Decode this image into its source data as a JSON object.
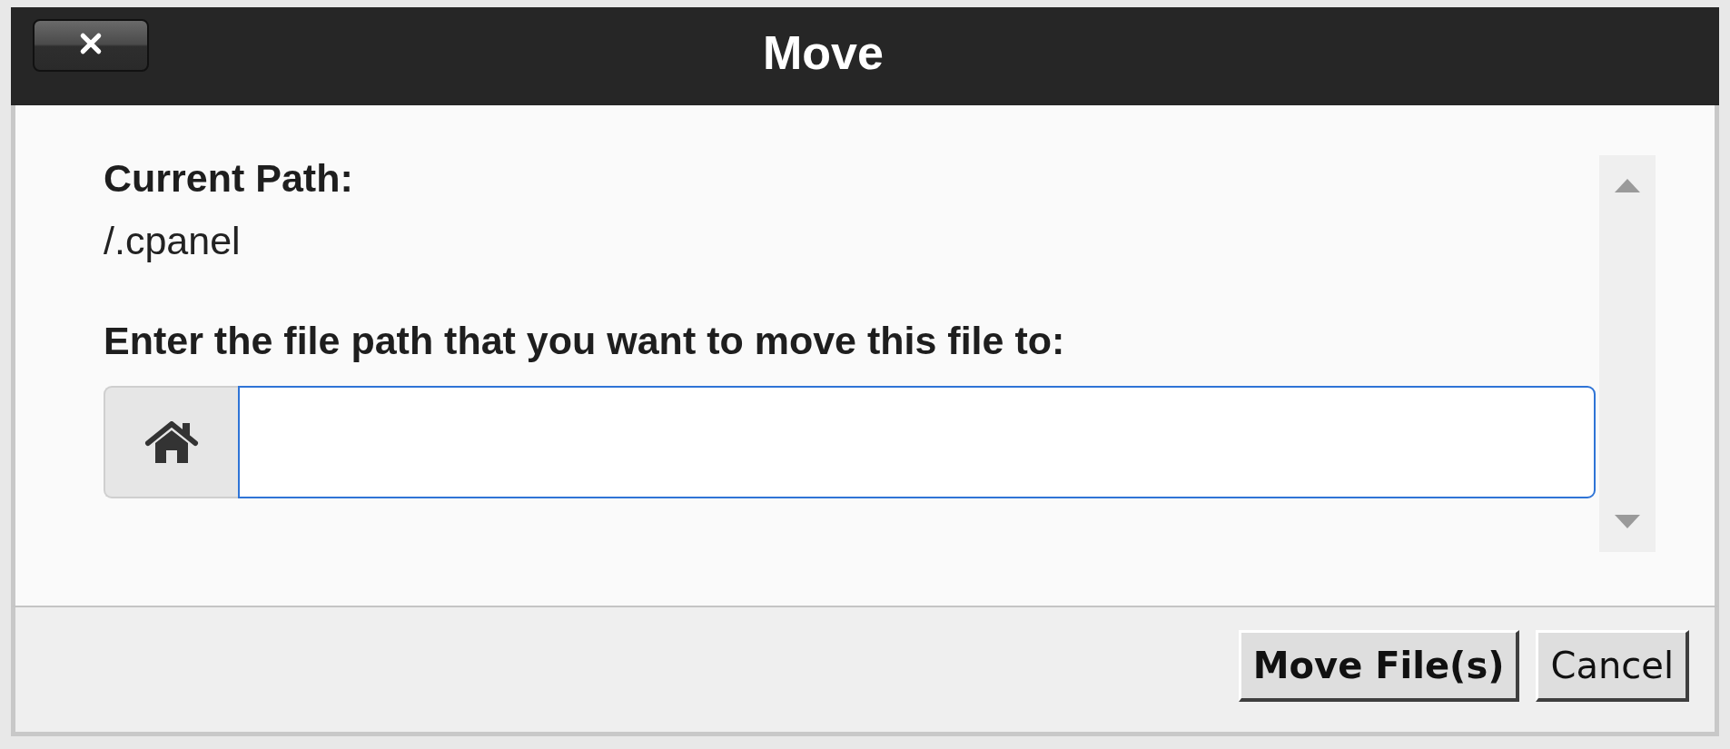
{
  "dialog": {
    "title": "Move"
  },
  "current_path": {
    "label": "Current Path:",
    "value": "/.cpanel"
  },
  "destination": {
    "label": "Enter the file path that you want to move this file to:",
    "focused": true
  },
  "buttons": [
    {
      "label": "Move File(s)",
      "kind": "primary"
    },
    {
      "label": "Cancel",
      "kind": "secondary"
    }
  ]
}
